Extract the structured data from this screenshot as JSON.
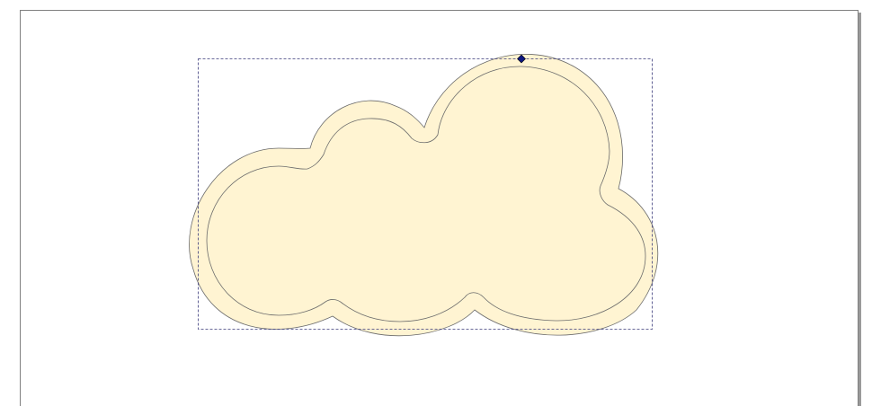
{
  "canvas": {
    "background_color": "#ffffff",
    "page_border_color": "#808080"
  },
  "cloud_shape": {
    "fill_color": "#fff4d2",
    "stroke_color": "#6b6b6b",
    "inner_outline_color": "#6b6b6b"
  },
  "selection": {
    "bounding_box_color": "#3a3a7a",
    "handle_color": "#0d1780",
    "handle_icon": "diamond-handle-icon"
  }
}
